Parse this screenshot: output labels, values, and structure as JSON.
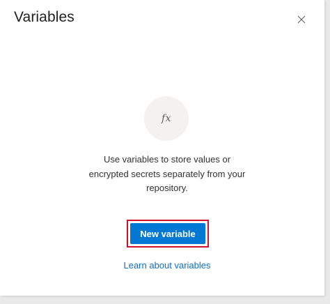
{
  "panel": {
    "title": "Variables",
    "close_icon": "close-icon"
  },
  "empty_state": {
    "icon": "fx-function-icon",
    "icon_glyph": "fx",
    "description": "Use variables to store values or encrypted secrets separately from your repository.",
    "primary_button_label": "New variable",
    "link_label": "Learn about variables"
  },
  "colors": {
    "accent": "#0078d4",
    "link": "#106ebe",
    "highlight": "#d0112b",
    "icon_circle": "#f3f2f1"
  }
}
